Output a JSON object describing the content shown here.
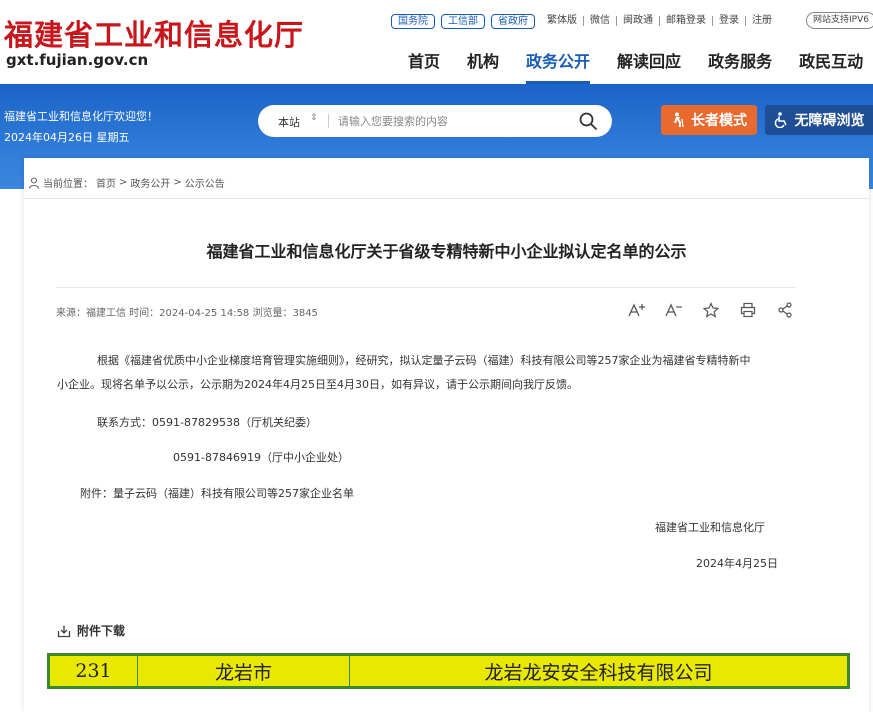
{
  "header": {
    "logo_cn": "福建省工业和信息化厅",
    "logo_en": "gxt.fujian.gov.cn",
    "pills": [
      "国务院",
      "工信部",
      "省政府"
    ],
    "top_links": [
      "繁体版",
      "微信",
      "闽政通",
      "邮箱登录",
      "登录",
      "注册"
    ],
    "ipv6": "网站支持IPV6",
    "nav": [
      "首页",
      "机构",
      "政务公开",
      "解读回应",
      "政务服务",
      "政民互动"
    ],
    "nav_active_index": 2
  },
  "band": {
    "welcome": "福建省工业和信息化厅欢迎您！",
    "date": "2024年04月26日 星期五",
    "search_scope": "本站",
    "search_placeholder": "请输入您要搜索的内容",
    "elder_mode": "长者模式",
    "accessible": "无障碍浏览"
  },
  "breadcrumb": {
    "label": "当前位置：",
    "items": [
      "首页",
      "政务公开",
      "公示公告"
    ],
    "sep": ">"
  },
  "article": {
    "title": "福建省工业和信息化厅关于省级专精特新中小企业拟认定名单的公示",
    "meta": "来源：福建工信  时间：2024-04-25 14:58  浏览量：3845",
    "para1_line1": "根据《福建省优质中小企业梯度培育管理实施细则》，经研究，拟认定量子云码（福建）科技有限公司等257家企业为福建省专精特新中",
    "para1_line2": "小企业。现将名单予以公示，公示期为2024年4月25日至4月30日，如有异议，请于公示期间向我厅反馈。",
    "contact1": "联系方式：0591-87829538（厅机关纪委）",
    "contact2": "0591-87846919（厅中小企业处）",
    "attachment": "附件：量子云码（福建）科技有限公司等257家企业名单",
    "signature": "福建省工业和信息化厅",
    "sign_date": "2024年4月25日"
  },
  "download": {
    "title": "附件下载"
  },
  "table_row": [
    "231",
    "龙岩市",
    "龙岩龙安安全科技有限公司"
  ],
  "colors": {
    "brand_red": "#c8161d",
    "brand_blue": "#1a5bb5",
    "elder_orange": "#e96a2e",
    "access_navy": "#1e4f96",
    "table_yellow": "#e8e800",
    "table_border": "#3a8a2a"
  }
}
